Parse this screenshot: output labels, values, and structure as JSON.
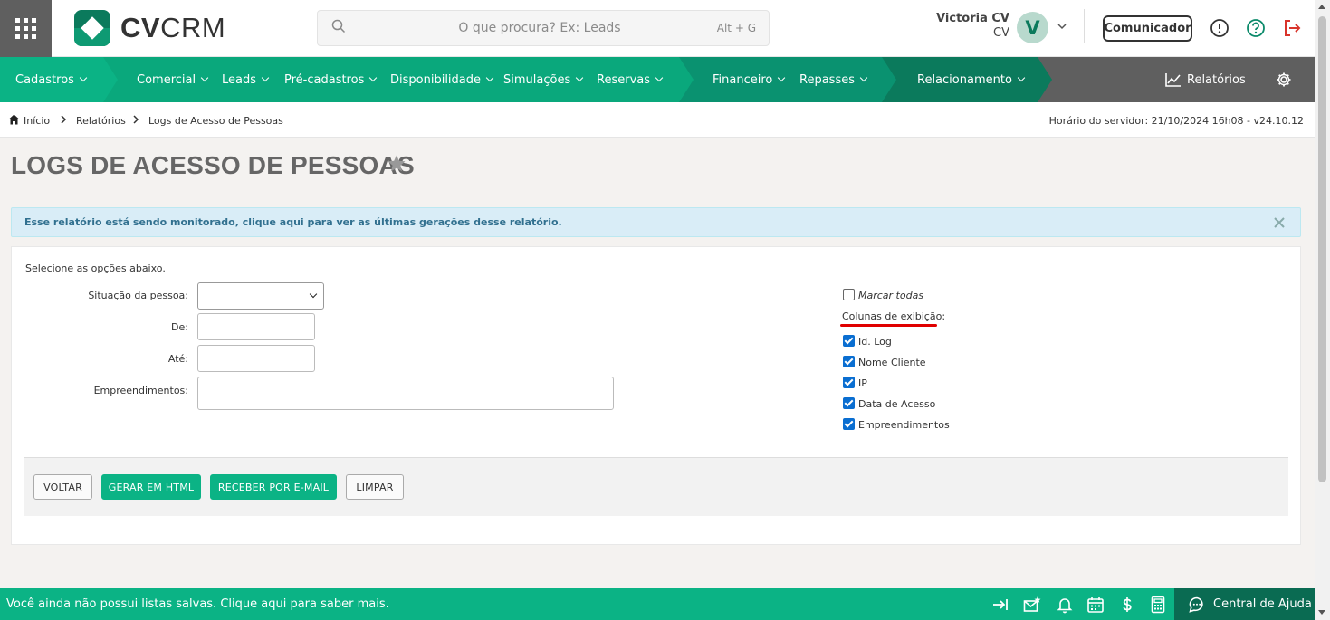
{
  "header": {
    "logo_text_bold": "CV",
    "logo_text_light": "CRM",
    "search_placeholder": "O que procura? Ex: Leads",
    "search_shortcut": "Alt + G",
    "user_name": "Victoria CV",
    "user_company": "CV",
    "avatar_letter": "V",
    "communicator_label": "Comunicador"
  },
  "nav": {
    "items": [
      {
        "label": "Cadastros"
      },
      {
        "label": "Comercial"
      },
      {
        "label": "Leads"
      },
      {
        "label": "Pré-cadastros"
      },
      {
        "label": "Disponibilidade"
      },
      {
        "label": "Simulações"
      },
      {
        "label": "Reservas"
      },
      {
        "label": "Financeiro"
      },
      {
        "label": "Repasses"
      },
      {
        "label": "Relacionamento"
      }
    ],
    "reports_label": "Relatórios",
    "colors": {
      "seg1": "#0bb385",
      "seg2": "#0aa87c",
      "seg3": "#0a9270",
      "seg4": "#0b7a5c",
      "gray": "#5f5f5f"
    }
  },
  "breadcrumb": {
    "items": [
      "Início",
      "Relatórios",
      "Logs de Acesso de Pessoas"
    ],
    "server_time": "Horário do servidor: 21/10/2024 16h08 - v24.10.12"
  },
  "page": {
    "title": "LOGS DE ACESSO DE PESSOAS",
    "alert": "Esse relatório está sendo monitorado, clique aqui para ver as últimas gerações desse relatório."
  },
  "form": {
    "intro": "Selecione as opções abaixo.",
    "labels": {
      "situacao": "Situação da pessoa:",
      "de": "De:",
      "ate": "Até:",
      "empreendimentos": "Empreendimentos:"
    },
    "values": {
      "situacao": "",
      "de": "",
      "ate": "",
      "empreendimentos": ""
    },
    "mark_all": {
      "label": "Marcar todas",
      "checked": false
    },
    "columns_title": "Colunas de exibição:",
    "columns": [
      {
        "label": "Id. Log",
        "checked": true
      },
      {
        "label": "Nome Cliente",
        "checked": true
      },
      {
        "label": "IP",
        "checked": true
      },
      {
        "label": "Data de Acesso",
        "checked": true
      },
      {
        "label": "Empreendimentos",
        "checked": true
      }
    ]
  },
  "buttons": {
    "back": "VOLTAR",
    "html": "GERAR EM HTML",
    "email": "RECEBER POR E-MAIL",
    "clear": "LIMPAR"
  },
  "footer": {
    "message": "Você ainda não possui listas salvas. Clique aqui para saber mais.",
    "help_label": "Central de Ajuda"
  }
}
